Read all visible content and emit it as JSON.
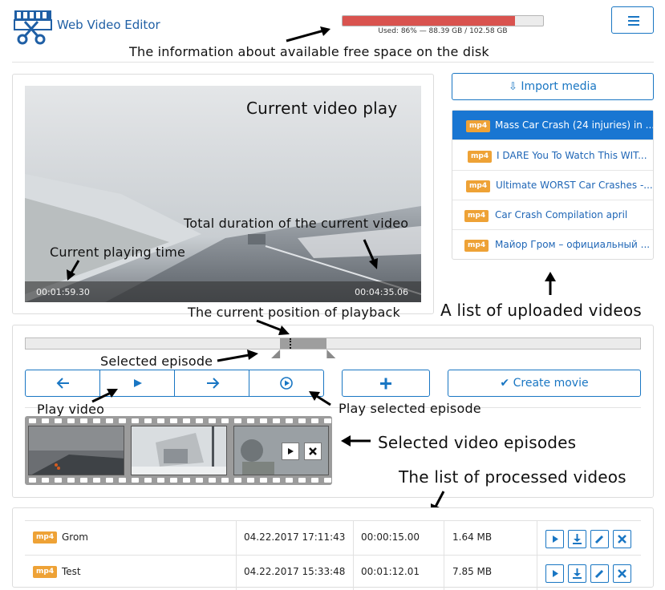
{
  "app": {
    "title": "Web Video Editor",
    "logo_icon": "film-scissors-logo-icon"
  },
  "disk": {
    "used_fraction": 0.86,
    "label": "Used: 86% — 88.39 GB / 102.58 GB",
    "fill_color": "#d9534f"
  },
  "menu": {
    "icon": "hamburger-menu-icon"
  },
  "annotations": {
    "disk_info": "The information about available free space on the disk",
    "current_video": "Current video play",
    "total_duration": "Total duration of the current video",
    "current_time": "Current playing time",
    "playback_position": "The current position of playback",
    "uploaded_list": "A list of uploaded videos",
    "selected_episode": "Selected episode",
    "play_video": "Play video",
    "play_selected": "Play selected episode",
    "selected_episodes": "Selected video episodes",
    "processed_list": "The list of processed videos"
  },
  "player": {
    "current_time": "00:01:59.30",
    "total_duration": "00:04:35.06"
  },
  "media": {
    "import_label": "Import media",
    "items": [
      {
        "format": "mp4",
        "title": "Mass Car Crash (24 injuries) in ...",
        "active": true
      },
      {
        "format": "mp4",
        "title": "I DARE You To Watch This WIT...",
        "active": false
      },
      {
        "format": "mp4",
        "title": "Ultimate WORST Car Crashes -...",
        "active": false
      },
      {
        "format": "mp4",
        "title": "Car Crash Compilation april",
        "active": false
      },
      {
        "format": "mp4",
        "title": "Майор Гром – официальный ...",
        "active": false
      }
    ]
  },
  "timeline": {
    "selection_start": 0.414,
    "selection_end": 0.49,
    "playhead": 0.43
  },
  "controls": {
    "prev_icon": "arrow-left-icon",
    "play_icon": "play-icon",
    "next_icon": "arrow-right-icon",
    "play_selected_icon": "play-circle-icon",
    "add_icon": "plus-icon",
    "create_label": "Create movie",
    "create_icon": "check-icon"
  },
  "processed": [
    {
      "format": "mp4",
      "name": "Grom",
      "date": "04.22.2017 17:11:43",
      "duration": "00:00:15.00",
      "size": "1.64 MB"
    },
    {
      "format": "mp4",
      "name": "Test",
      "date": "04.22.2017 15:33:48",
      "duration": "00:01:12.01",
      "size": "7.85 MB"
    }
  ],
  "colors": {
    "accent": "#1976c3",
    "badge": "#eea236",
    "active_item": "#1976d2"
  }
}
